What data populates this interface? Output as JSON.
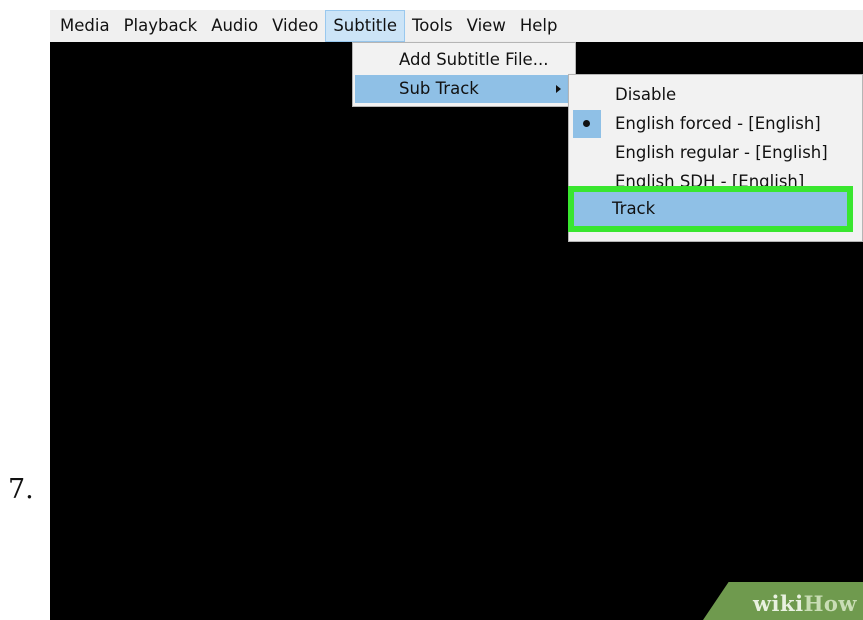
{
  "step_number": "7.",
  "menubar": {
    "items": [
      {
        "label": "Media"
      },
      {
        "label": "Playback"
      },
      {
        "label": "Audio"
      },
      {
        "label": "Video"
      },
      {
        "label": "Subtitle"
      },
      {
        "label": "Tools"
      },
      {
        "label": "View"
      },
      {
        "label": "Help"
      }
    ],
    "active_item": "Subtitle"
  },
  "subtitle_menu": {
    "items": [
      {
        "label": "Add Subtitle File..."
      },
      {
        "label": "Sub Track",
        "has_submenu": true,
        "highlighted": true
      }
    ]
  },
  "sub_track_menu": {
    "items": [
      {
        "label": "Disable",
        "checked": false
      },
      {
        "label": "English forced - [English]",
        "checked": true
      },
      {
        "label": "English regular - [English]",
        "checked": false
      },
      {
        "label": "English SDH - [English]",
        "checked": false
      },
      {
        "label": "Track",
        "highlighted": true
      }
    ]
  },
  "callout": {
    "color": "#39e62f"
  },
  "watermark": {
    "wiki": "wiki",
    "how": "How"
  },
  "colors": {
    "menu_background": "#f0f0f0",
    "highlight": "#8fc0e6",
    "video_area": "#000000"
  }
}
